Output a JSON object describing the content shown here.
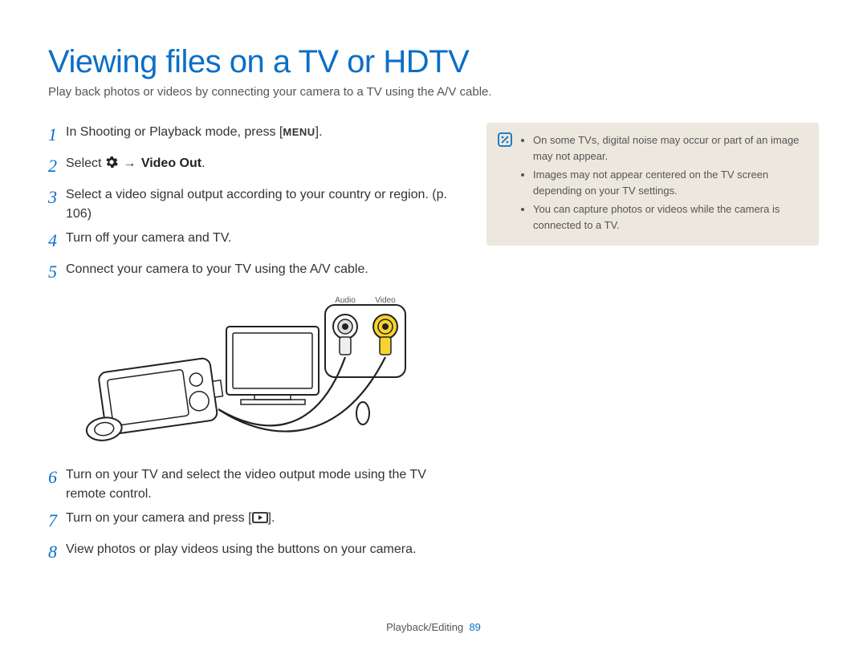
{
  "title": "Viewing files on a TV or HDTV",
  "subtitle": "Play back photos or videos by connecting your camera to a TV using the A/V cable.",
  "steps": {
    "s1a": "In Shooting or Playback mode, press [",
    "s1_menu": "MENU",
    "s1b": "].",
    "s2a": "Select ",
    "s2_arrow": "→",
    "s2_bold": " Video Out",
    "s2b": ".",
    "s3": "Select a video signal output according to your country or region. (p. 106)",
    "s4": "Turn off your camera and TV.",
    "s5": "Connect your camera to your TV using the A/V cable.",
    "s6": "Turn on your TV and select the video output mode using the TV remote control.",
    "s7a": "Turn on your camera and press [",
    "s7b": "].",
    "s8": "View photos or play videos using the buttons on your camera."
  },
  "diagram": {
    "audio_label": "Audio",
    "video_label": "Video"
  },
  "notes": {
    "n1": "On some TVs, digital noise may occur or part of an image may not appear.",
    "n2": "Images may not appear centered on the TV screen depending on your TV settings.",
    "n3": "You can capture photos or videos while the camera is connected to a TV."
  },
  "footer": {
    "section": "Playback/Editing",
    "page": "89"
  }
}
